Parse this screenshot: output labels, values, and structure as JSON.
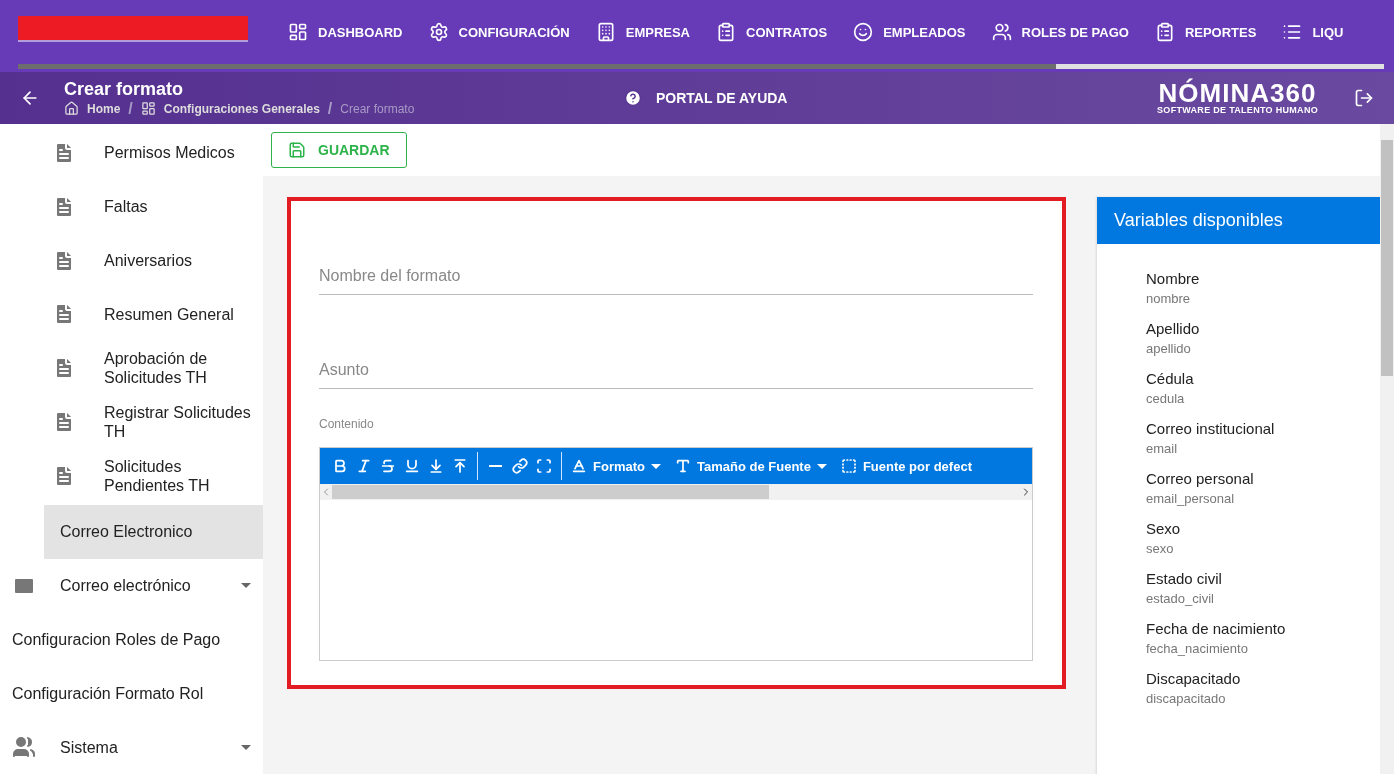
{
  "nav": {
    "items": [
      {
        "label": "DASHBOARD"
      },
      {
        "label": "CONFIGURACIÓN"
      },
      {
        "label": "EMPRESA"
      },
      {
        "label": "CONTRATOS"
      },
      {
        "label": "EMPLEADOS"
      },
      {
        "label": "ROLES DE PAGO"
      },
      {
        "label": "REPORTES"
      },
      {
        "label": "LIQU"
      }
    ],
    "progress": {
      "level": 0.76
    }
  },
  "header": {
    "title": "Crear formato",
    "breadcrumb": [
      {
        "label": "Home"
      },
      {
        "separator": "/",
        "label": "Configuraciones Generales"
      },
      {
        "separator": "/",
        "label": "Crear formato"
      }
    ],
    "help": "PORTAL DE AYUDA",
    "logo": {
      "name": "NÓMINA360",
      "tagline": "SOFTWARE DE TALENTO HUMANO"
    }
  },
  "sidebar": {
    "items": [
      {
        "kind": "report",
        "label": "Permisos Medicos",
        "selected": false
      },
      {
        "kind": "report",
        "label": "Faltas",
        "selected": false
      },
      {
        "kind": "report",
        "label": "Aniversarios",
        "selected": false
      },
      {
        "kind": "report",
        "label": "Resumen General",
        "selected": false
      },
      {
        "kind": "report",
        "label": "Aprobación de Solicitudes TH",
        "selected": false
      },
      {
        "kind": "report",
        "label": "Registrar Solicitudes TH",
        "selected": false
      },
      {
        "kind": "report",
        "label": "Solicitudes Pendientes TH",
        "selected": false
      },
      {
        "kind": "sub",
        "label": "Correo Electronico",
        "selected": true
      },
      {
        "kind": "group",
        "label": "Correo electrónico",
        "selected": false
      },
      {
        "kind": "plain",
        "label": "Configuracion Roles de Pago",
        "selected": false
      },
      {
        "kind": "plain",
        "label": "Configuración Formato Rol",
        "selected": false
      },
      {
        "kind": "group",
        "label": "Sistema",
        "selected": false
      }
    ]
  },
  "save_button": "GUARDAR",
  "form": {
    "name_field": {
      "placeholder": "Nombre del formato"
    },
    "subject_field": {
      "placeholder": "Asunto"
    },
    "content_label": "Contenido",
    "toolbar": {
      "dropdowns": [
        {
          "label": "Formato"
        },
        {
          "label": "Tamaño de Fuente"
        },
        {
          "label": "Fuente por defect"
        }
      ]
    }
  },
  "variables": {
    "title": "Variables disponibles",
    "items": [
      {
        "label": "Nombre",
        "key": "nombre"
      },
      {
        "label": "Apellido",
        "key": "apellido"
      },
      {
        "label": "Cédula",
        "key": "cedula"
      },
      {
        "label": "Correo institucional",
        "key": "email"
      },
      {
        "label": "Correo personal",
        "key": "email_personal"
      },
      {
        "label": "Sexo",
        "key": "sexo"
      },
      {
        "label": "Estado civil",
        "key": "estado_civil"
      },
      {
        "label": "Fecha de nacimiento",
        "key": "fecha_nacimiento"
      },
      {
        "label": "Discapacitado",
        "key": "discapacitado"
      }
    ]
  }
}
